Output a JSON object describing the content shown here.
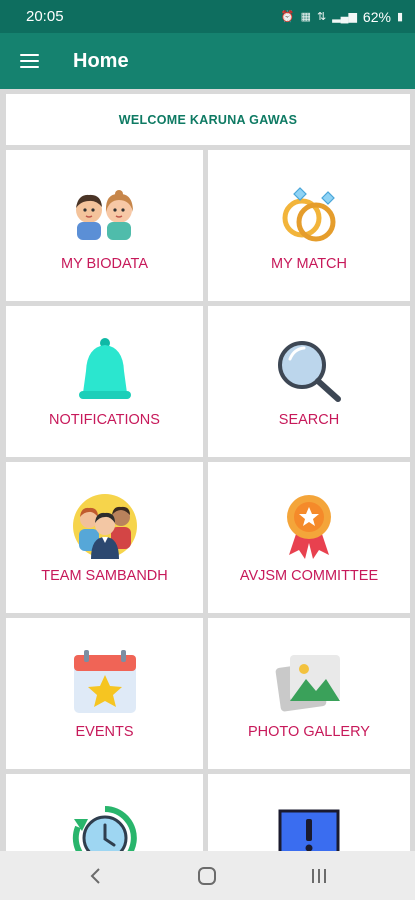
{
  "status_bar": {
    "time": "20:05",
    "battery": "62%",
    "icons": [
      "alarm-icon",
      "volte-icon",
      "4g-icon",
      "signal-icon",
      "battery-icon"
    ]
  },
  "app_bar": {
    "title": "Home",
    "menu_icon": "hamburger-menu-icon"
  },
  "welcome": {
    "text": "WELCOME KARUNA GAWAS"
  },
  "tiles": [
    {
      "label": "MY BIODATA",
      "icon": "couple-icon"
    },
    {
      "label": "MY MATCH",
      "icon": "rings-icon"
    },
    {
      "label": "NOTIFICATIONS",
      "icon": "bell-icon"
    },
    {
      "label": "SEARCH",
      "icon": "magnifier-icon"
    },
    {
      "label": "TEAM SAMBANDH",
      "icon": "team-icon"
    },
    {
      "label": "AVJSM COMMITTEE",
      "icon": "award-badge-icon"
    },
    {
      "label": "EVENTS",
      "icon": "calendar-star-icon"
    },
    {
      "label": "PHOTO GALLERY",
      "icon": "gallery-icon"
    },
    {
      "label": "",
      "icon": "history-clock-icon"
    },
    {
      "label": "",
      "icon": "alert-icon"
    }
  ],
  "colors": {
    "status_bar": "#0e6e5f",
    "app_bar": "#15826f",
    "welcome_text": "#0e7a63",
    "tile_label": "#c7195a",
    "background": "#d9d9d9"
  },
  "nav_bar": {
    "buttons": [
      "back-icon",
      "home-icon",
      "recents-icon"
    ]
  }
}
